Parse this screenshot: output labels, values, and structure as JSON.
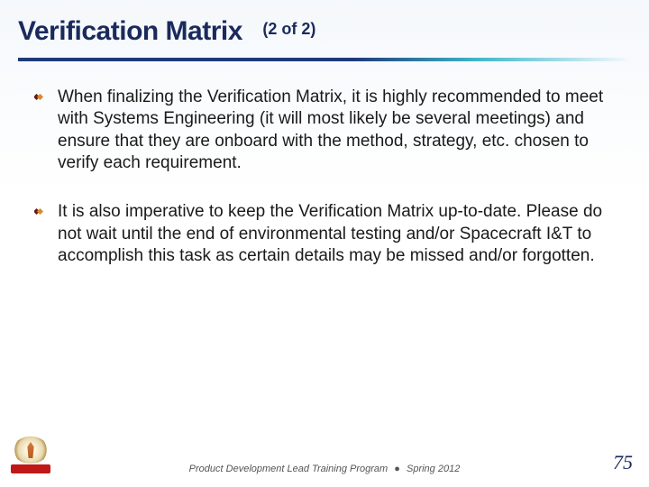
{
  "header": {
    "title": "Verification Matrix",
    "subtitle": "(2 of 2)"
  },
  "bullets": [
    "When finalizing the Verification Matrix, it is highly recommended to meet with Systems Engineering (it will most likely be several meetings) and ensure that they are onboard with the method, strategy, etc. chosen to verify each requirement.",
    "It is also imperative to keep the Verification Matrix up-to-date.  Please do not wait until the end of environmental testing and/or Spacecraft I&T to accomplish this task as certain details may be missed and/or forgotten."
  ],
  "footer": {
    "program": "Product Development Lead Training Program",
    "separator": "●",
    "date": "Spring 2012",
    "page": "75"
  }
}
